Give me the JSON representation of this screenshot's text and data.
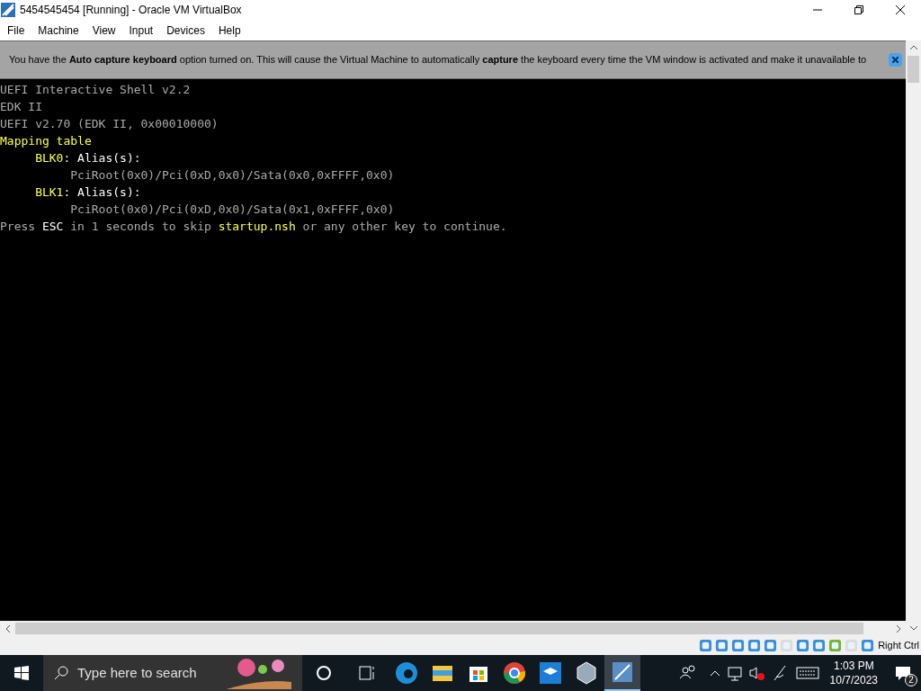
{
  "window": {
    "title": "5454545454 [Running] - Oracle VM VirtualBox"
  },
  "menu": [
    "File",
    "Machine",
    "View",
    "Input",
    "Devices",
    "Help"
  ],
  "notice": {
    "text": "You have the **Auto capture keyboard** option turned on. This will cause the Virtual Machine to automatically **capture** the keyboard every time the VM window is activated and make it unavailable to"
  },
  "console": [
    [
      {
        "text": "UEFI Interactive Shell v2.2",
        "color": "#aaaaaa"
      }
    ],
    [
      {
        "text": "EDK II",
        "color": "#aaaaaa"
      }
    ],
    [
      {
        "text": "UEFI v2.70 (EDK II, 0x00010000)",
        "color": "#aaaaaa"
      }
    ],
    [
      {
        "text": "Mapping table",
        "color": "#ffff55"
      }
    ],
    [
      {
        "text": "     BLK0",
        "color": "#ffff55"
      },
      {
        "text": ": Alias(s):",
        "color": "#ffffff"
      }
    ],
    [
      {
        "text": "          PciRoot(0x0)/Pci(0xD,0x0)/Sata(0x0,0xFFFF,0x0)",
        "color": "#aaaaaa"
      }
    ],
    [
      {
        "text": "     BLK1",
        "color": "#ffff55"
      },
      {
        "text": ": Alias(s):",
        "color": "#ffffff"
      }
    ],
    [
      {
        "text": "          PciRoot(0x0)/Pci(0xD,0x0)/Sata(0x1,0xFFFF,0x0)",
        "color": "#aaaaaa"
      }
    ],
    [
      {
        "text": "Press ",
        "color": "#aaaaaa"
      },
      {
        "text": "ESC",
        "color": "#ffffff"
      },
      {
        "text": " in 1 seconds to skip ",
        "color": "#aaaaaa"
      },
      {
        "text": "startup.nsh",
        "color": "#ffff55"
      },
      {
        "text": " or any other key to continue.",
        "color": "#aaaaaa"
      }
    ]
  ],
  "status_bar": {
    "host_key": "Right Ctrl"
  },
  "taskbar": {
    "search_placeholder": "Type here to search",
    "time": "1:03 PM",
    "date": "10/7/2023",
    "notifications": "2"
  }
}
